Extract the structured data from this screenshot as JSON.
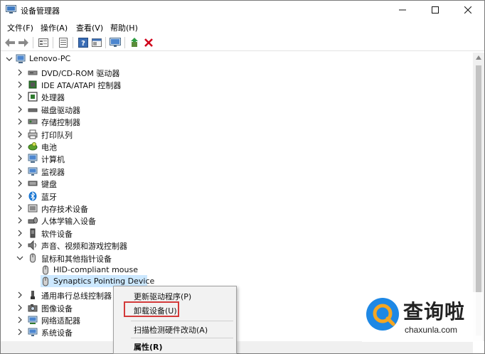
{
  "window": {
    "title": "设备管理器"
  },
  "menu": [
    "文件(F)",
    "操作(A)",
    "查看(V)",
    "帮助(H)"
  ],
  "toolbar": {
    "buttons": [
      "back-arrow-icon",
      "forward-arrow-icon",
      "properties-icon",
      "list-view-icon",
      "help-icon",
      "console-icon",
      "monitor-icon",
      "update-driver-icon",
      "uninstall-x-icon"
    ]
  },
  "tree": {
    "root": "Lenovo-PC",
    "nodes": [
      {
        "label": "DVD/CD-ROM 驱动器",
        "icon": "dvd-drive-icon",
        "state": "collapsed"
      },
      {
        "label": "IDE ATA/ATAPI 控制器",
        "icon": "ide-controller-icon",
        "state": "collapsed"
      },
      {
        "label": "处理器",
        "icon": "processor-icon",
        "state": "collapsed"
      },
      {
        "label": "磁盘驱动器",
        "icon": "disk-drive-icon",
        "state": "collapsed"
      },
      {
        "label": "存储控制器",
        "icon": "storage-controller-icon",
        "state": "collapsed"
      },
      {
        "label": "打印队列",
        "icon": "printer-icon",
        "state": "collapsed"
      },
      {
        "label": "电池",
        "icon": "battery-icon",
        "state": "collapsed"
      },
      {
        "label": "计算机",
        "icon": "computer-icon",
        "state": "collapsed"
      },
      {
        "label": "监视器",
        "icon": "monitor-icon",
        "state": "collapsed"
      },
      {
        "label": "键盘",
        "icon": "keyboard-icon",
        "state": "collapsed"
      },
      {
        "label": "蓝牙",
        "icon": "bluetooth-icon",
        "state": "collapsed"
      },
      {
        "label": "内存技术设备",
        "icon": "memory-device-icon",
        "state": "collapsed"
      },
      {
        "label": "人体学输入设备",
        "icon": "hid-icon",
        "state": "collapsed"
      },
      {
        "label": "软件设备",
        "icon": "software-device-icon",
        "state": "collapsed"
      },
      {
        "label": "声音、视频和游戏控制器",
        "icon": "speaker-icon",
        "state": "collapsed"
      },
      {
        "label": "鼠标和其他指针设备",
        "icon": "mouse-icon",
        "state": "expanded"
      },
      {
        "label": "HID-compliant mouse",
        "icon": "mouse-icon",
        "state": "child"
      },
      {
        "label": "Synaptics Pointing Device",
        "icon": "mouse-icon",
        "state": "child-selected"
      },
      {
        "label": "通用串行总线控制器",
        "icon": "usb-icon",
        "state": "collapsed"
      },
      {
        "label": "图像设备",
        "icon": "camera-icon",
        "state": "collapsed"
      },
      {
        "label": "网络适配器",
        "icon": "network-adapter-icon",
        "state": "collapsed"
      },
      {
        "label": "系统设备",
        "icon": "system-device-icon",
        "state": "collapsed"
      }
    ]
  },
  "context_menu": {
    "items": [
      "更新驱动程序(P)",
      "卸载设备(U)",
      "扫描检测硬件改动(A)",
      "属性(R)"
    ],
    "highlighted": "卸载设备(U)",
    "highlight_color": "#d33a3a"
  },
  "watermark": {
    "cn": "查询啦",
    "en": "chaxunla.com",
    "brand_color": "#1e88e5",
    "accent_color": "#f5a623"
  }
}
